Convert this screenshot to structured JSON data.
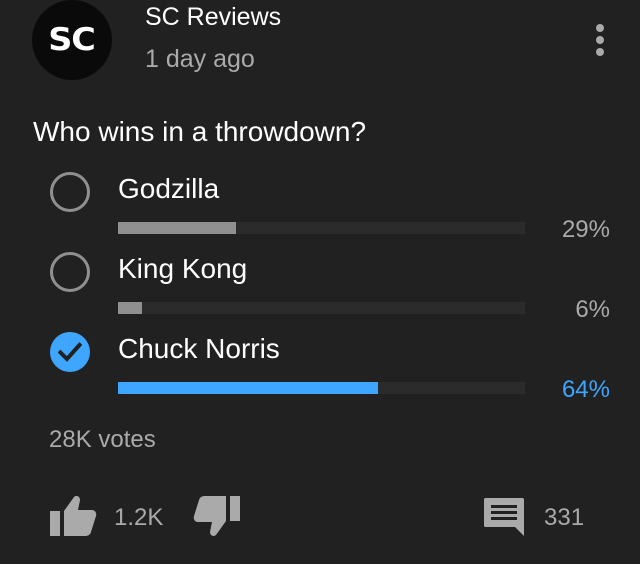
{
  "post": {
    "avatar_text": "SC",
    "channel_name": "SC Reviews",
    "timestamp": "1 day ago",
    "question": "Who wins in a throwdown?"
  },
  "poll": {
    "options": [
      {
        "label": "Godzilla",
        "percent_text": "29%",
        "percent": 29,
        "selected": false
      },
      {
        "label": "King Kong",
        "percent_text": "6%",
        "percent": 6,
        "selected": false
      },
      {
        "label": "Chuck Norris",
        "percent_text": "64%",
        "percent": 64,
        "selected": true
      }
    ],
    "votes": "28K votes"
  },
  "actions": {
    "like_count": "1.2K",
    "comment_count": "331"
  },
  "colors": {
    "background": "#212121",
    "accent": "#3ea6ff",
    "muted": "#aaaaaa",
    "bar_unselected": "#909090",
    "bar_track": "#2b2b2b"
  },
  "icons": {
    "menu": "more-vert-icon",
    "radio_unchecked": "radio-unchecked-icon",
    "radio_checked": "check-circle-icon",
    "like": "thumb-up-icon",
    "dislike": "thumb-down-icon",
    "comment": "comment-icon"
  }
}
